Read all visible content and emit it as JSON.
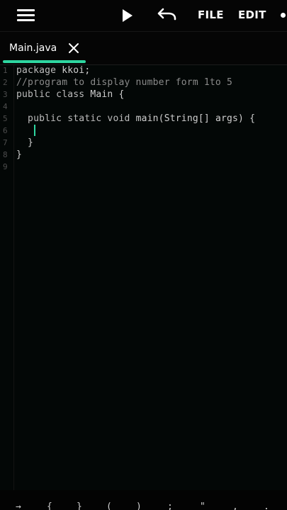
{
  "toolbar": {
    "file_label": "FILE",
    "edit_label": "EDIT",
    "icons": [
      "menu-icon",
      "play-icon",
      "undo-icon",
      "more-icon"
    ]
  },
  "tabs": [
    {
      "label": "Main.java",
      "active": true
    }
  ],
  "editor": {
    "line_numbers": [
      "1",
      "2",
      "3",
      "4",
      "5",
      "6",
      "7",
      "8",
      "9"
    ],
    "lines": [
      {
        "pre": "package",
        "rest": " kkoi;"
      },
      {
        "comment": "//program to display number form 1to 5"
      },
      {
        "pre": "public class",
        "rest": " Main {"
      },
      {
        "text": ""
      },
      {
        "pre": "  public static void",
        "rest": " main(String[] args) {"
      },
      {
        "text": ""
      },
      {
        "text": "  }"
      },
      {
        "text": "}"
      },
      {
        "text": ""
      }
    ]
  },
  "colors": {
    "accent": "#2ed6a0",
    "background": "#030303"
  },
  "bottom_keys": [
    "→",
    "{",
    "}",
    "(",
    ")",
    ";",
    "\"",
    ",",
    "."
  ]
}
